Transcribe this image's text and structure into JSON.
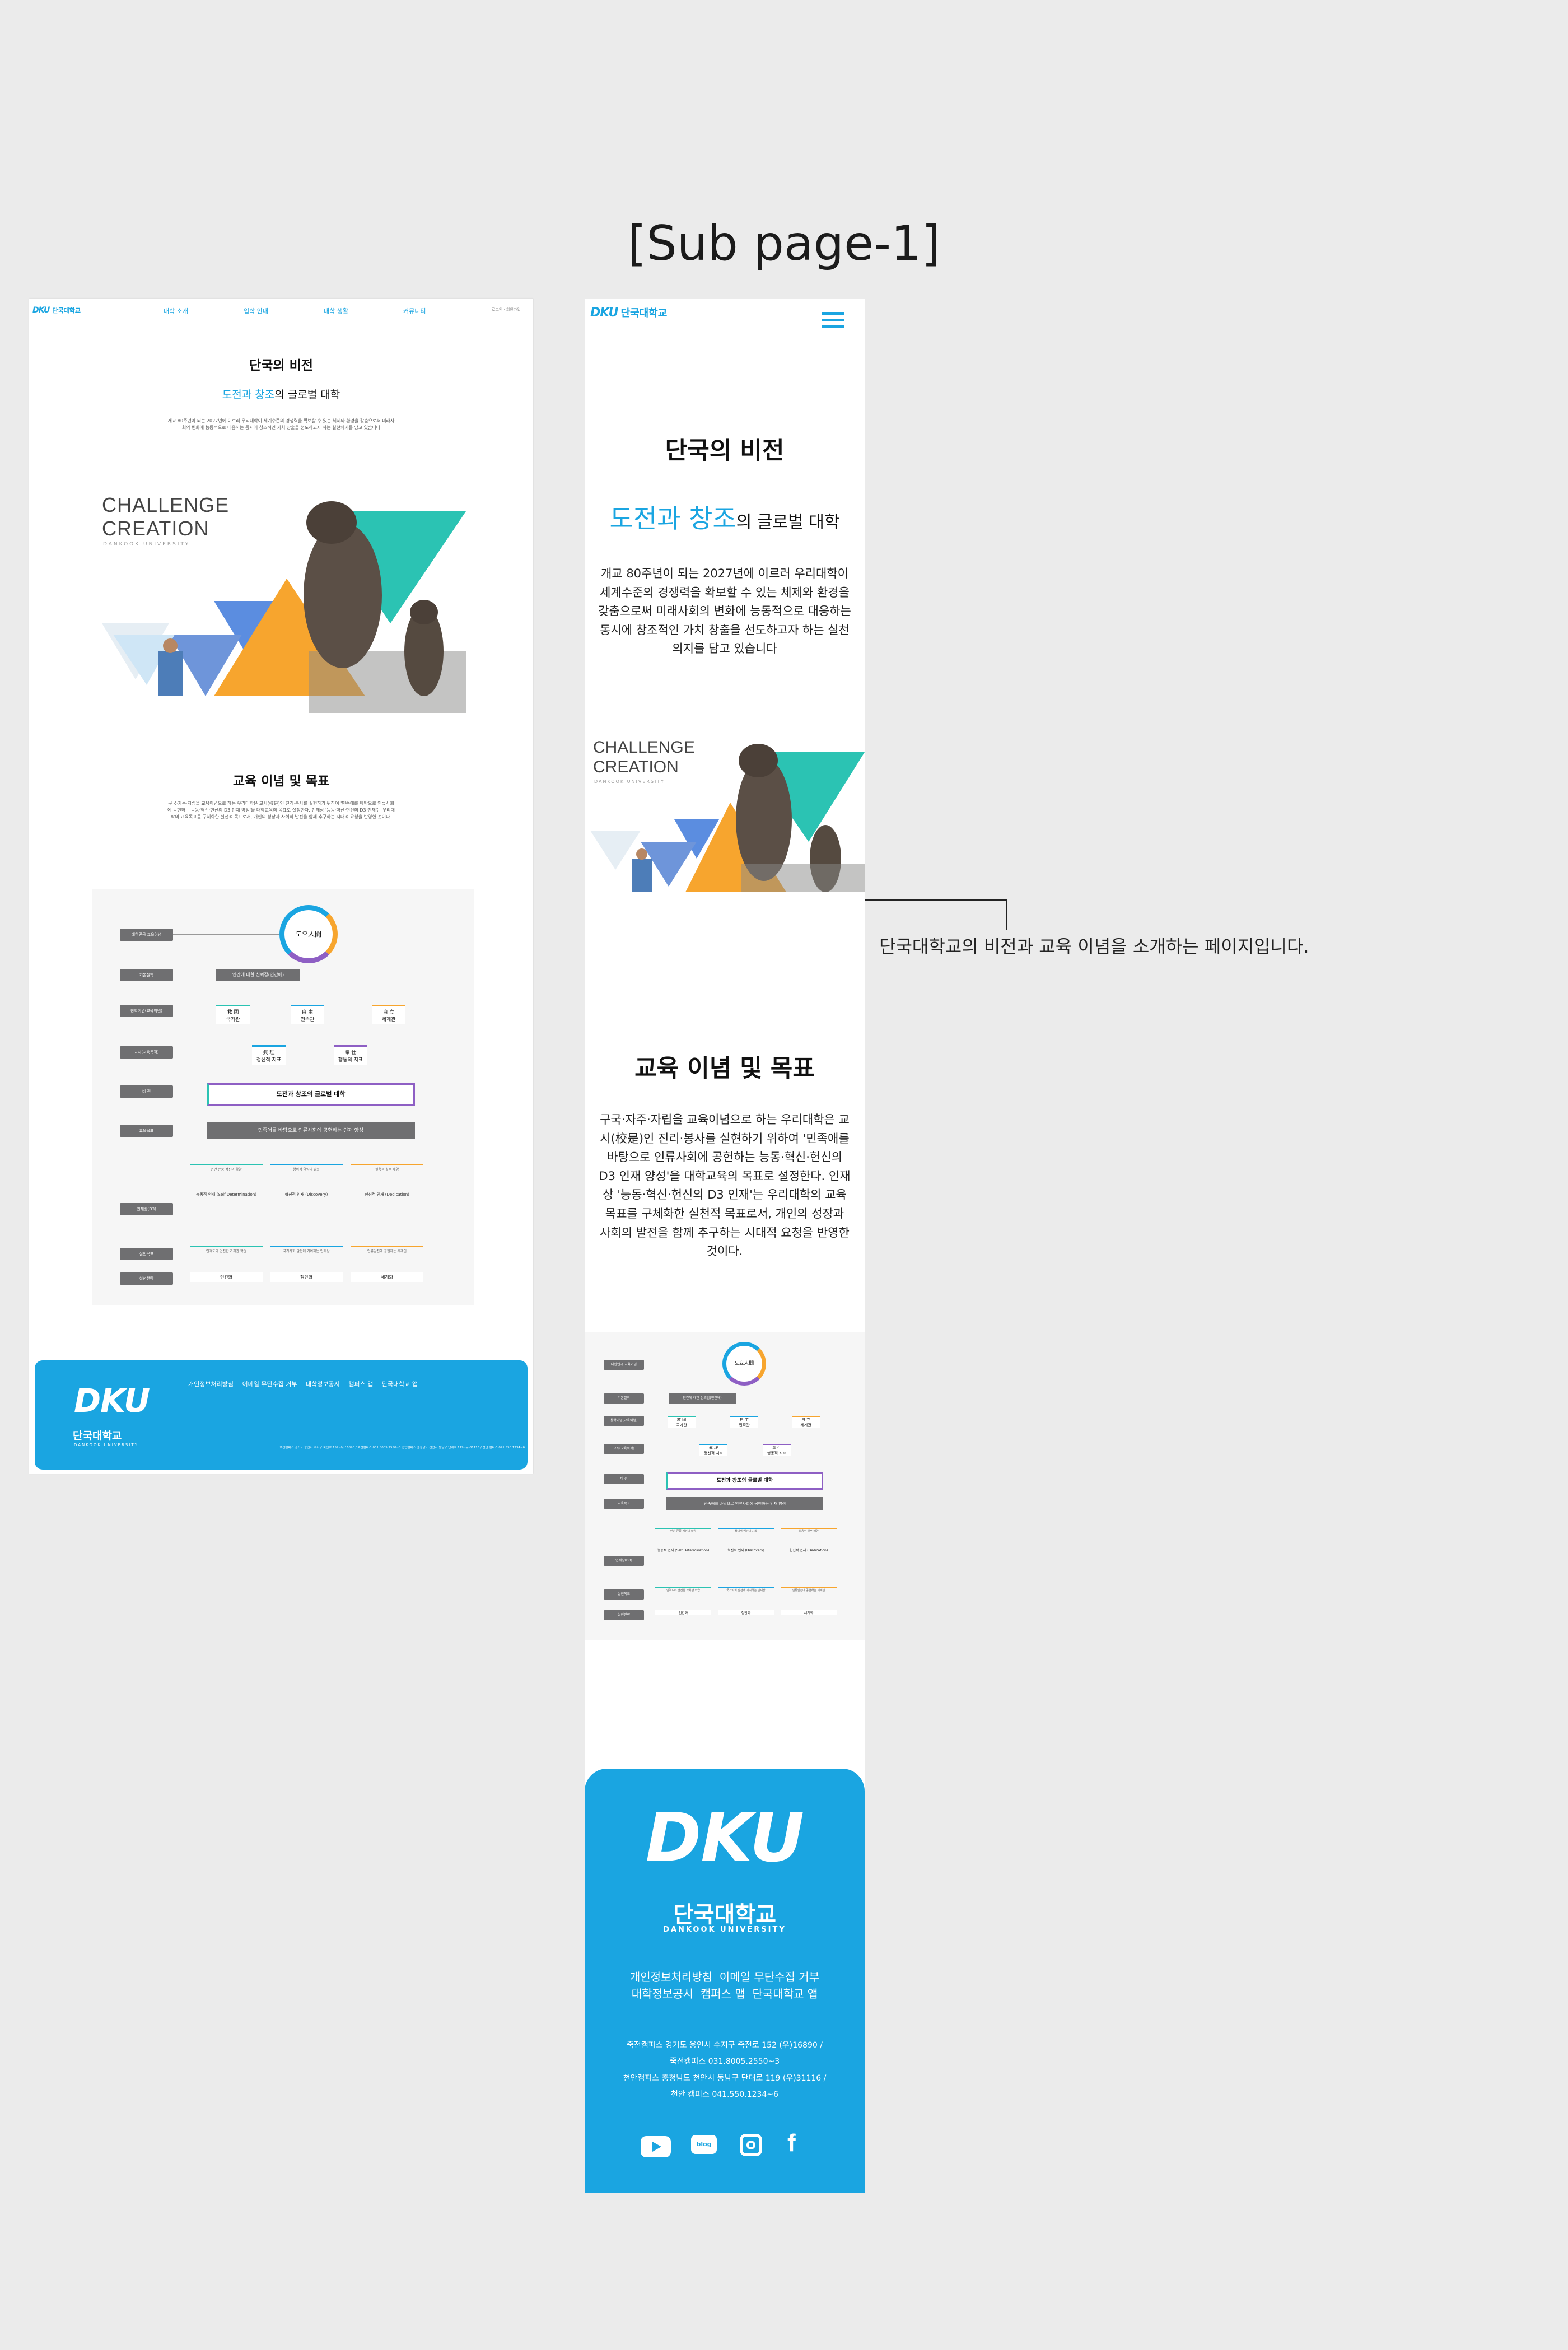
{
  "page": {
    "title": "[Sub page-1]"
  },
  "annotation": {
    "text": "단국대학교의 비전과 교육 이념을 소개하는 페이지입니다."
  },
  "brand": {
    "logo_mark": "DKU",
    "name_kr": "단국대학교",
    "name_en": "DANKOOK UNIVERSITY",
    "accent": "#1aa5e1"
  },
  "desktop": {
    "nav": [
      "대학 소개",
      "입학 안내",
      "대학 생활",
      "커뮤니티"
    ],
    "util": [
      "로그인",
      "회원가입"
    ],
    "vision_title": "단국의 비전",
    "vision_highlight": "도전과 창조",
    "vision_rest": "의 글로벌 대학",
    "vision_body": "개교 80주년이 되는 2027년에 이르러 우리대학이 세계수준의 경쟁력을 확보할 수 있는 체제와 환경을 갖춤으로써 미래사회의 변화에 능동적으로 대응하는 동시에 창조적인 가치 창출을 선도하고자 하는 실천의지를 담고 있습니다",
    "challenge_1": "CHALLENGE",
    "challenge_2": "CREATION",
    "challenge_sub": "DANKOOK UNIVERSITY",
    "edu_title": "교육 이념 및 목표",
    "edu_body": "구국·자주·자립을 교육이념으로 하는 우리대학은 교시(校是)인 진리·봉사를 실현하기 위하여 '민족애를 바탕으로 인류사회에 공헌하는 능동·혁신·헌신의 D3 인재 양성'을 대학교육의 목표로 설정한다. 인재상 '능동·혁신·헌신의 D3 인재'는 우리대학의 교육목표를 구체화한 실천적 목표로서, 개인의 성장과 사회의 발전을 함께 추구하는 시대적 요청을 반영한 것이다."
  },
  "diagram": {
    "labels": [
      "대한민국 교육이념",
      "기본철학",
      "창학이념(교육이념)",
      "교시(교육목적)",
      "비 전",
      "교육목표",
      "인재상(D3)",
      "실천목표",
      "실천전략"
    ],
    "center": "도요人間",
    "philosophy": "인간에 대한 신뢰감(인간애)",
    "ideals": [
      {
        "kr": "救 國",
        "sub": "국가관"
      },
      {
        "kr": "自 主",
        "sub": "민족관"
      },
      {
        "kr": "自 立",
        "sub": "세계관"
      }
    ],
    "motto": [
      {
        "kr": "眞 理",
        "sub": "정신적 지표"
      },
      {
        "kr": "奉 仕",
        "sub": "행동적 지표"
      }
    ],
    "vision": "도전과 창조의 글로벌 대학",
    "goal": "민족애를 바탕으로 인류사회에 공헌하는 인재 양성",
    "d3_heads": [
      "인간 존중 정신의 함양",
      "창의적 역량의 강화",
      "실용적 실무 배양"
    ],
    "d3_titles": [
      "능동적 인재 (Self Determination)",
      "혁신적 인재 (Discovery)",
      "헌신적 인재 (Dedication)"
    ],
    "practice": [
      "인격도야 건전한 가치관 학습",
      "국가사회 발전에 기여하는 인재상",
      "인류발전에 공헌하는 세계인"
    ],
    "strategy": [
      "인간화",
      "첨단화",
      "세계화"
    ]
  },
  "footer": {
    "links": [
      "개인정보처리방침",
      "이메일 무단수집 거부",
      "대학정보공시",
      "캠퍼스 맵",
      "단국대학교 앱"
    ],
    "address": [
      "죽전캠퍼스 경기도 용인시 수지구 죽전로 152 (우)16890 /",
      "죽전캠퍼스 031.8005.2550~3",
      "천안캠퍼스 충청남도 천안시 동남구 단대로 119 (우)31116 /",
      "천안 캠퍼스 041.550.1234~6"
    ],
    "social": [
      "youtube-icon",
      "blog-icon",
      "instagram-icon",
      "facebook-icon"
    ]
  }
}
